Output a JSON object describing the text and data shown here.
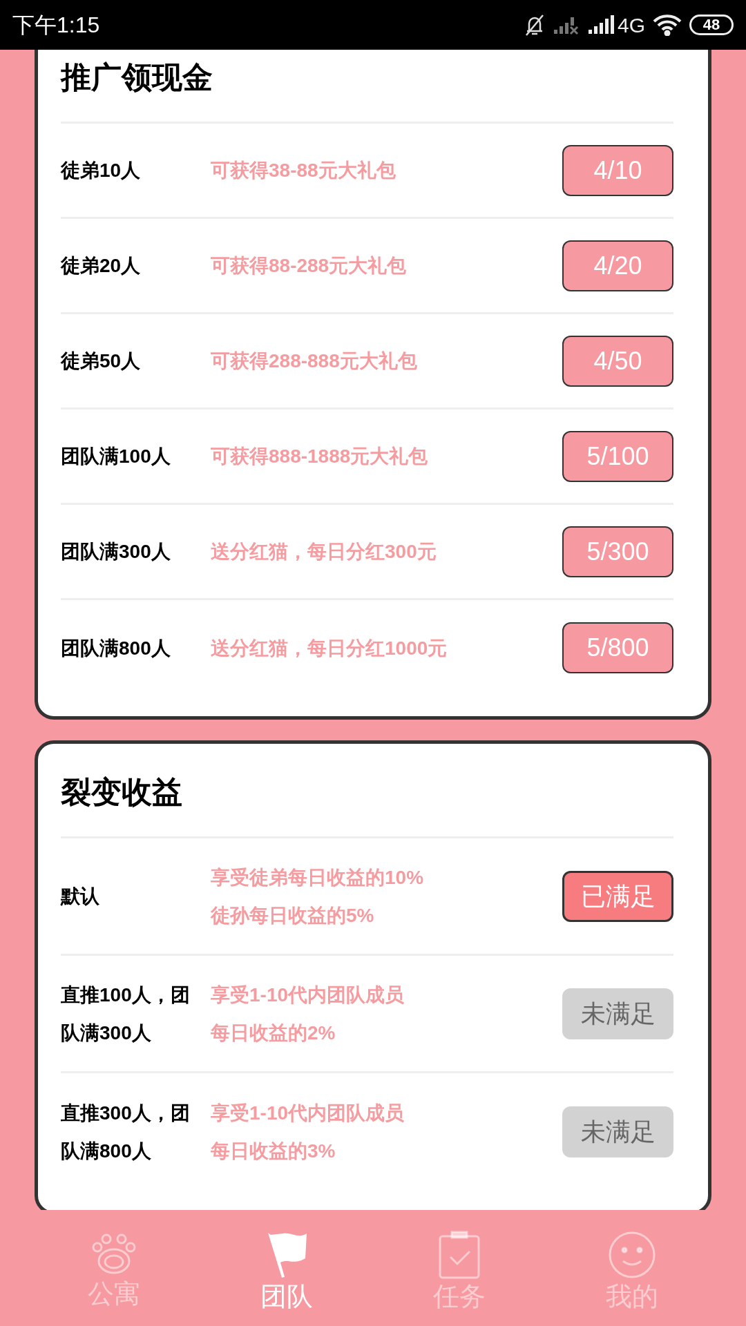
{
  "status_bar": {
    "time": "下午1:15",
    "network": "4G",
    "battery": "48"
  },
  "sections": [
    {
      "title": "推广领现金",
      "rows": [
        {
          "label": "徒弟10人",
          "description": "可获得38-88元大礼包",
          "button": "4/10",
          "kind": "progress"
        },
        {
          "label": "徒弟20人",
          "description": "可获得88-288元大礼包",
          "button": "4/20",
          "kind": "progress"
        },
        {
          "label": "徒弟50人",
          "description": "可获得288-888元大礼包",
          "button": "4/50",
          "kind": "progress"
        },
        {
          "label": "团队满100人",
          "description": "可获得888-1888元大礼包",
          "button": "5/100",
          "kind": "progress"
        },
        {
          "label": "团队满300人",
          "description": "送分红猫，每日分红300元",
          "button": "5/300",
          "kind": "progress"
        },
        {
          "label": "团队满800人",
          "description": "送分红猫，每日分红1000元",
          "button": "5/800",
          "kind": "progress"
        }
      ]
    },
    {
      "title": "裂变收益",
      "rows": [
        {
          "label": "默认",
          "description_lines": [
            "享受徒弟每日收益的10%",
            "徒孙每日收益的5%"
          ],
          "button": "已满足",
          "kind": "met"
        },
        {
          "label": "直推100人，团队满300人",
          "description_lines": [
            "享受1-10代内团队成员",
            "每日收益的2%"
          ],
          "button": "未满足",
          "kind": "unmet"
        },
        {
          "label": "直推300人，团队满800人",
          "description_lines": [
            "享受1-10代内团队成员",
            "每日收益的3%"
          ],
          "button": "未满足",
          "kind": "unmet"
        }
      ]
    }
  ],
  "tab_bar": [
    {
      "label": "公寓",
      "selected": false
    },
    {
      "label": "团队",
      "selected": true
    },
    {
      "label": "任务",
      "selected": false
    },
    {
      "label": "我的",
      "selected": false
    }
  ]
}
